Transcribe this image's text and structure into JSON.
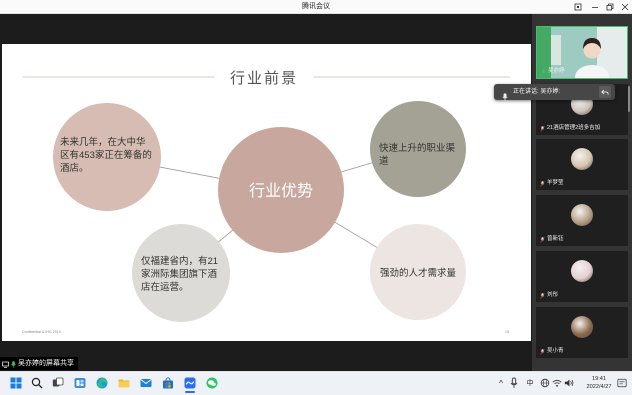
{
  "window": {
    "title": "腾讯会议",
    "controls": [
      "pin-icon",
      "minimize-icon",
      "restore-icon",
      "close-icon"
    ]
  },
  "slide": {
    "title": "行业前景",
    "center": "行业优势",
    "nodes": [
      {
        "lines": [
          "未来几年，在大中华",
          "区有453家正在筹备的",
          "酒店。"
        ]
      },
      {
        "lines": [
          "仅福建省内，有21",
          "家洲际集团旗下酒",
          "店在运营。"
        ]
      },
      {
        "lines": [
          "快速上升的职业渠",
          "道"
        ]
      },
      {
        "lines": [
          "强劲的人才需求量"
        ]
      }
    ],
    "footer": "Confidential & IHG 2019",
    "page_number": "15",
    "colors": {
      "center": "#c8a79f",
      "node_1": "#d6bcb2",
      "node_2": "#dcdbd7",
      "node_3": "#a3a294",
      "node_4": "#ede5e2",
      "rule": "#d9b9b3",
      "connector": "#9b9b9b"
    }
  },
  "share_label": "吴亦婷的屏幕共享",
  "speaking_tooltip": {
    "text": "正在讲话: 吴亦婷:",
    "icon": "mic-icon",
    "action_icon": "reply-icon"
  },
  "participants": [
    {
      "name": "吴亦婷",
      "video": true,
      "speaking": true
    },
    {
      "name": "21酒店管理2班多吉加",
      "avatar_color": "#cdc5bd"
    },
    {
      "name": "羊梦莹",
      "avatar_color": "#d6c4ae"
    },
    {
      "name": "曾新钰",
      "avatar_color": "#b79f88"
    },
    {
      "name": "刘彤",
      "avatar_color": "#e5d0d2"
    },
    {
      "name": "吴小青",
      "avatar_color": "#8d6a4c"
    }
  ],
  "taskbar": {
    "apps": [
      "windows-start-icon",
      "search-icon",
      "task-view-icon",
      "widgets-icon",
      "edge-icon",
      "file-explorer-icon",
      "mail-icon",
      "store-icon",
      "tencent-meeting-icon",
      "wechat-icon"
    ],
    "active_app": "tencent-meeting-icon",
    "tray_expand": "^",
    "ime": "中",
    "time": "19:41",
    "date": "2022/4/27"
  },
  "colors": {
    "accent": "#3cc46b",
    "panel": "#343434",
    "stage": "#1c1c1c",
    "meeting_blue": "#2a6ef0"
  }
}
